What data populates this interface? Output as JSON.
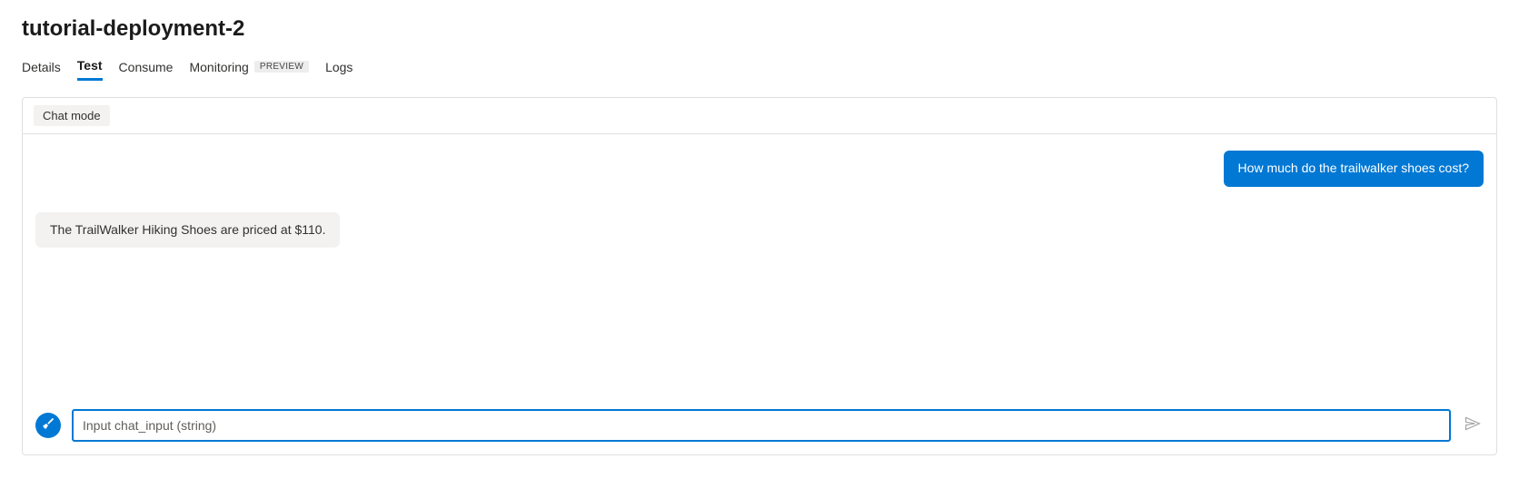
{
  "header": {
    "title": "tutorial-deployment-2"
  },
  "tabs": [
    {
      "label": "Details",
      "active": false
    },
    {
      "label": "Test",
      "active": true
    },
    {
      "label": "Consume",
      "active": false
    },
    {
      "label": "Monitoring",
      "active": false,
      "badge": "PREVIEW"
    },
    {
      "label": "Logs",
      "active": false
    }
  ],
  "panel": {
    "mode_label": "Chat mode"
  },
  "chat": {
    "messages": [
      {
        "role": "user",
        "text": "How much do the trailwalker shoes cost?"
      },
      {
        "role": "assistant",
        "text": "The TrailWalker Hiking Shoes are priced at $110."
      }
    ],
    "input_value": "",
    "input_placeholder": "Input chat_input (string)"
  }
}
